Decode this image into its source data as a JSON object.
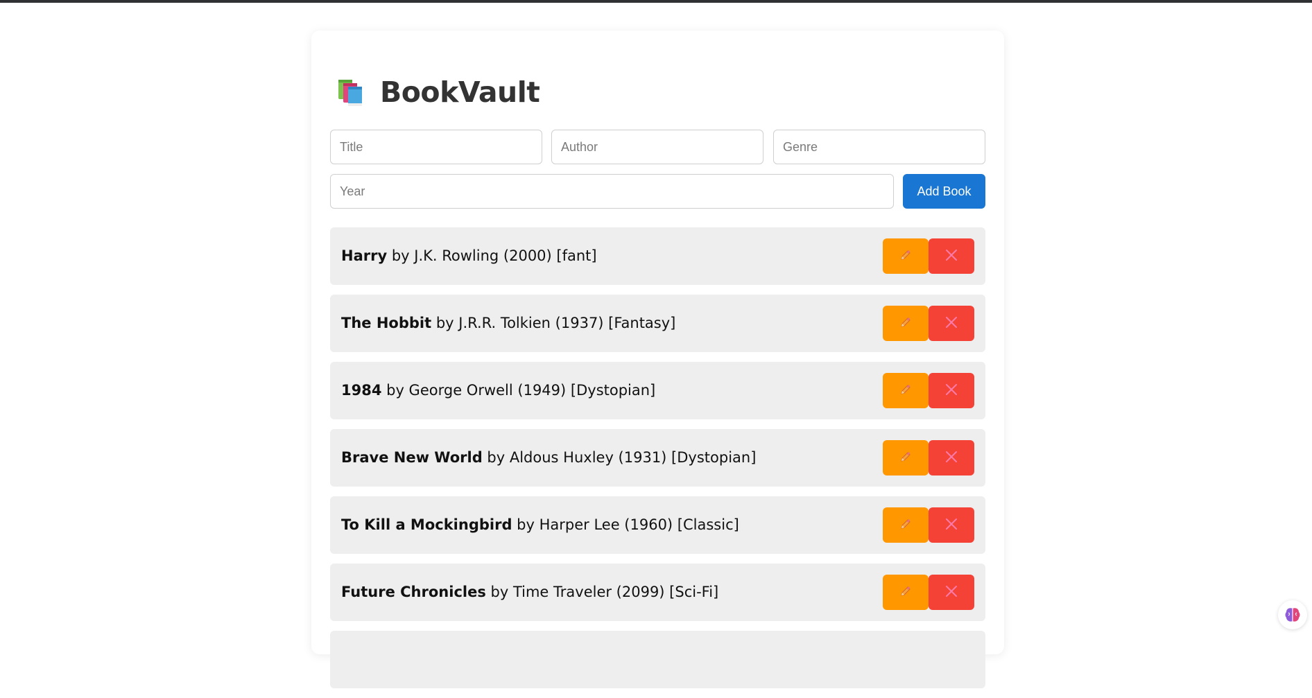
{
  "app": {
    "title": "BookVault",
    "logo_icon": "books-icon"
  },
  "form": {
    "title_placeholder": "Title",
    "author_placeholder": "Author",
    "genre_placeholder": "Genre",
    "year_placeholder": "Year",
    "title_value": "",
    "author_value": "",
    "genre_value": "",
    "year_value": "",
    "add_button_label": "Add Book"
  },
  "books": [
    {
      "title": "Harry",
      "details": " by J.K. Rowling (2000) [fant]"
    },
    {
      "title": "The Hobbit",
      "details": " by J.R.R. Tolkien (1937) [Fantasy]"
    },
    {
      "title": "1984",
      "details": " by George Orwell (1949) [Dystopian]"
    },
    {
      "title": "Brave New World",
      "details": " by Aldous Huxley (1931) [Dystopian]"
    },
    {
      "title": "To Kill a Mockingbird",
      "details": " by Harper Lee (1960) [Classic]"
    },
    {
      "title": "Future Chronicles",
      "details": " by Time Traveler (2099) [Sci-Fi]"
    }
  ],
  "actions": {
    "edit_icon": "pencil-icon",
    "delete_icon": "close-icon"
  },
  "colors": {
    "accent": "#1976d2",
    "edit": "#ff9800",
    "delete": "#f44336",
    "row_bg": "#eeeeee"
  }
}
